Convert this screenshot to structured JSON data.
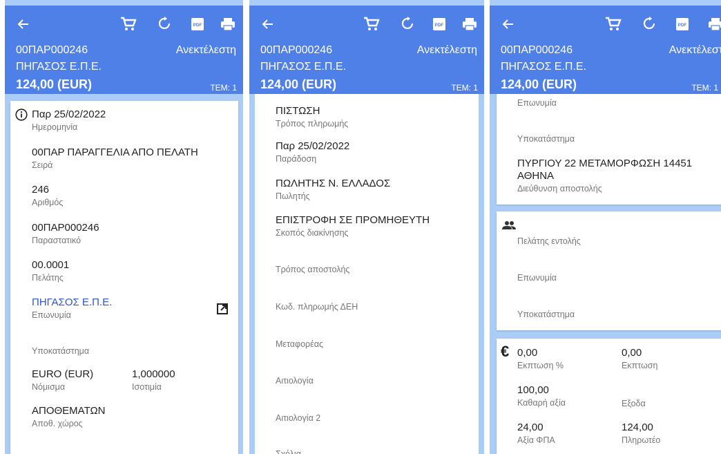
{
  "header": {
    "code": "00ΠΑΡ000246",
    "status": "Ανεκτέλεστη",
    "company": "ΠΗΓΑΣΟΣ Ε.Π.Ε.",
    "amount": "124,00 (EUR)",
    "items": "ΤΕΜ: 1",
    "icons": [
      "back-arrow-icon",
      "cart-icon",
      "refresh-icon",
      "pdf-icon",
      "print-icon"
    ],
    "pdf_text": "PDF"
  },
  "colors": {
    "header": "#4f80e8",
    "background": "#a9cdf6",
    "link": "#2f55c6"
  },
  "panel1": {
    "date": {
      "value": "Παρ 25/02/2022",
      "label": "Ημερομηνία"
    },
    "series": {
      "value": "00ΠΑΡ ΠΑΡΑΓΓΕΛΙΑ ΑΠΟ ΠΕΛΑΤΗ",
      "label": "Σειρά"
    },
    "number": {
      "value": "246",
      "label": "Αριθμός"
    },
    "document": {
      "value": "00ΠΑΡ000246",
      "label": "Παραστατικό"
    },
    "customer": {
      "value": "00.0001",
      "label": "Πελάτης"
    },
    "name": {
      "value": "ΠΗΓΑΣΟΣ Ε.Π.Ε.",
      "label": "Επωνυμία"
    },
    "branch": {
      "label": "Υποκατάστημα"
    },
    "currency": {
      "value": "EURO (EUR)",
      "label": "Νόμισμα"
    },
    "rate": {
      "value": "1,000000",
      "label": "Ισοτιμία"
    },
    "warehouse": {
      "value": "ΑΠΟΘΕΜΑΤΩΝ",
      "label": "Αποθ. χώρος"
    }
  },
  "panel2": {
    "payment": {
      "value": "ΠΙΣΤΩΣΗ",
      "label": "Τρόπος πληρωμής"
    },
    "delivery": {
      "value": "Παρ 25/02/2022",
      "label": "Παράδοση"
    },
    "seller": {
      "value": "ΠΩΛΗΤΗΣ Ν. ΕΛΛΑΔΟΣ",
      "label": "Πωλητής"
    },
    "purpose": {
      "value": "ΕΠΙΣΤΡΟΦΗ ΣΕ ΠΡΟΜΗΘΕΥΤΗ",
      "label": "Σκοπός διακίνησης"
    },
    "shipping": {
      "label": "Τρόπος αποστολής"
    },
    "dei_code": {
      "label": "Κωδ. πληρωμής ΔΕΗ"
    },
    "carrier": {
      "label": "Μεταφορέας"
    },
    "reason": {
      "label": "Αιτιολογία"
    },
    "reason2": {
      "label": "Αιτιολογία 2"
    },
    "comments": {
      "label": "Σχόλια"
    }
  },
  "panel3": {
    "name_top": {
      "label": "Επωνυμία"
    },
    "branch": {
      "label": "Υποκατάστημα"
    },
    "address": {
      "line1": "ΠΥΡΓΙΟΥ 22 ΜΕΤΑΜΟΡΦΩΣΗ 14451",
      "line2": "ΑΘΗΝΑ",
      "label": "Διεύθυνση αποστολής"
    },
    "order_customer": {
      "label": "Πελάτης εντολής"
    },
    "order_name": {
      "label": "Επωνυμία"
    },
    "order_branch": {
      "label": "Υποκατάστημα"
    },
    "discount_pct": {
      "value": "0,00",
      "label": "Εκπτωση %"
    },
    "discount": {
      "value": "0,00",
      "label": "Εκπτωση"
    },
    "net": {
      "value": "100,00",
      "label": "Καθαρή αξία"
    },
    "expenses": {
      "label": "Εξοδα"
    },
    "vat": {
      "value": "24,00",
      "label": "Αξία ΦΠΑ"
    },
    "payable": {
      "value": "124,00",
      "label": "Πληρωτέο"
    }
  }
}
